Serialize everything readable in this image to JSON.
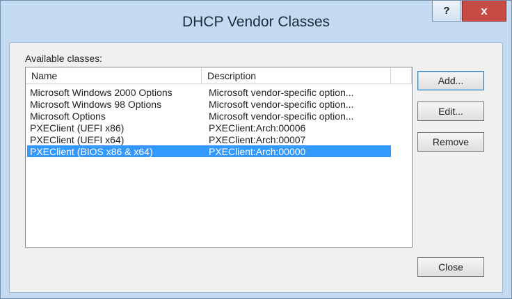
{
  "window": {
    "title": "DHCP Vendor Classes",
    "help_label": "?",
    "close_label": "x"
  },
  "available_label": "Available classes:",
  "columns": [
    "Name",
    "Description"
  ],
  "rows": [
    {
      "name": "Microsoft Windows 2000 Options",
      "description": "Microsoft vendor-specific option..."
    },
    {
      "name": "Microsoft Windows 98 Options",
      "description": "Microsoft vendor-specific option..."
    },
    {
      "name": "Microsoft Options",
      "description": "Microsoft vendor-specific option..."
    },
    {
      "name": "PXEClient (UEFI x86)",
      "description": "PXEClient:Arch:00006"
    },
    {
      "name": "PXEClient (UEFI x64)",
      "description": "PXEClient:Arch:00007"
    },
    {
      "name": "PXEClient (BIOS x86 & x64)",
      "description": "PXEClient:Arch:00000",
      "selected": true
    }
  ],
  "buttons": {
    "add": "Add...",
    "edit": "Edit...",
    "remove": "Remove",
    "close": "Close"
  },
  "colors": {
    "frame": "#c3daf0",
    "close_button": "#c64b44",
    "selection": "#3399ff"
  }
}
